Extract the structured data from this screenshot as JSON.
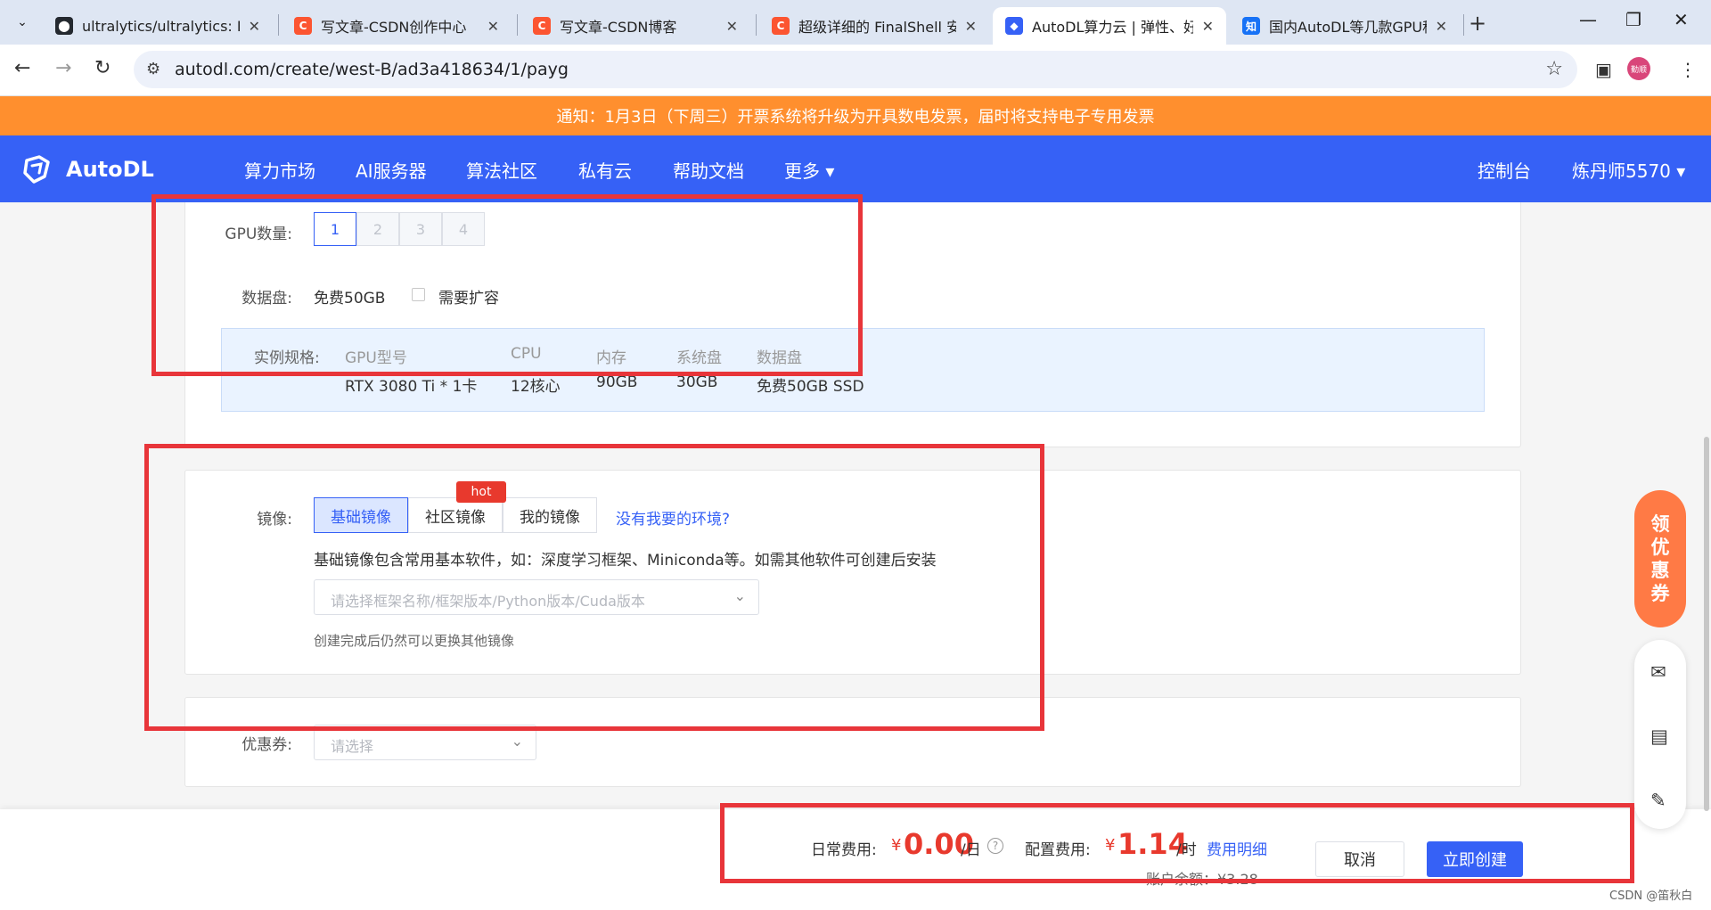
{
  "browser": {
    "tabs": [
      {
        "title": "ultralytics/ultralytics: NE",
        "favicon": "github-icon",
        "fav_bg": "#24292f"
      },
      {
        "title": "写文章-CSDN创作中心",
        "favicon": "csdn-icon",
        "fav_bg": "#fc5531"
      },
      {
        "title": "写文章-CSDN博客",
        "favicon": "csdn-icon",
        "fav_bg": "#fc5531"
      },
      {
        "title": "超级详细的 FinalShell 安装",
        "favicon": "csdn-icon",
        "fav_bg": "#fc5531"
      },
      {
        "title": "AutoDL算力云 | 弹性、好用",
        "favicon": "autodl-icon",
        "fav_bg": "#3661f6"
      },
      {
        "title": "国内AutoDL等几款GPU租",
        "favicon": "zhihu-icon",
        "fav_bg": "#1772f6"
      }
    ],
    "fav_glyphs": [
      "⬤",
      "C",
      "C",
      "C",
      "◆",
      "知"
    ],
    "active_tab": 4,
    "url": "autodl.com/create/west-B/ad3a418634/1/payg",
    "profile_label": "勤顺"
  },
  "notice": {
    "text": "通知：1月3日（下周三）开票系统将升级为开具数电发票，届时将支持电子专用发票"
  },
  "sitenav": {
    "brand": "AutoDL",
    "items": [
      "算力市场",
      "AI服务器",
      "算法社区",
      "私有云",
      "帮助文档",
      "更多 ▾"
    ],
    "console": "控制台",
    "user": "炼丹师5570 ▾"
  },
  "gpu": {
    "label": "GPU数量:",
    "options": [
      "1",
      "2",
      "3",
      "4"
    ],
    "selected": "1"
  },
  "disk": {
    "label": "数据盘:",
    "free": "免费50GB",
    "expand_label": "需要扩容"
  },
  "spec": {
    "label": "实例规格:",
    "headers": [
      "GPU型号",
      "CPU",
      "内存",
      "系统盘",
      "数据盘"
    ],
    "values": [
      "RTX 3080 Ti * 1卡",
      "12核心",
      "90GB",
      "30GB",
      "免费50GB SSD"
    ]
  },
  "image": {
    "label": "镜像:",
    "tabs": [
      "基础镜像",
      "社区镜像",
      "我的镜像"
    ],
    "selected_tab": "基础镜像",
    "hot_badge": "hot",
    "missing_link": "没有我要的环境?",
    "description": "基础镜像包含常用基本软件，如：深度学习框架、Miniconda等。如需其他软件可创建后安装",
    "select_placeholder": "请选择框架名称/框架版本/Python版本/Cuda版本",
    "hint": "创建完成后仍然可以更换其他镜像"
  },
  "coupon": {
    "label": "优惠券:",
    "placeholder": "请选择"
  },
  "footer": {
    "daily_label": "日常费用:",
    "currency": "¥",
    "daily_value": "0.00",
    "daily_unit": "/日",
    "config_label": "配置费用:",
    "config_value": "1.14",
    "config_unit": "/时",
    "detail_link": "费用明细",
    "cancel": "取消",
    "create": "立即创建",
    "balance": "账户余额：¥3.28"
  },
  "float": {
    "coupon_chars": [
      "领",
      "优",
      "惠",
      "券"
    ]
  },
  "watermark": "CSDN @笛秋白",
  "colors": {
    "brand": "#3661f6",
    "notice": "#ff8f2e",
    "price": "#e8392d",
    "annotation": "#e8353a"
  }
}
